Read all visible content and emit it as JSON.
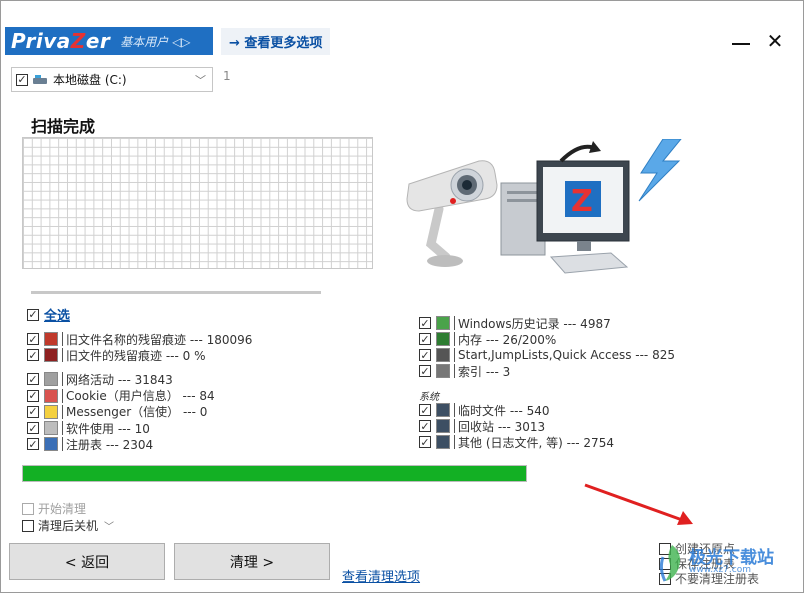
{
  "header": {
    "brand_prefix": "Priva",
    "brand_z": "Z",
    "brand_suffix": "er",
    "brand_sub": "基本用户 ◁▷",
    "more_options": "→ 查看更多选项",
    "close": "✕"
  },
  "drive": {
    "label": "本地磁盘 (C:)",
    "count": "1"
  },
  "scan_status": "扫描完成",
  "select_all": "全选",
  "left_items": [
    {
      "label": "旧文件名称的残留痕迹 ---  180096",
      "icon": "file-names-icon",
      "color": "#c0392b"
    },
    {
      "label": "旧文件的残留痕迹 ---  0 %",
      "icon": "file-grid-icon",
      "color": "#8e2020"
    },
    {
      "label": "网络活动 ---  31843",
      "icon": "fingerprint-icon",
      "color": "#a0a0a0"
    },
    {
      "label": "Cookie（用户信息） ---  84",
      "icon": "cookie-icon",
      "color": "#d9534f"
    },
    {
      "label": "Messenger（信使） ---  0",
      "icon": "messenger-icon",
      "color": "#f4d03f"
    },
    {
      "label": "软件使用 ---  10",
      "icon": "software-icon",
      "color": "#bdbdbd"
    },
    {
      "label": "注册表 --- 2304",
      "icon": "registry-icon",
      "color": "#3b6fb6"
    }
  ],
  "right_items": [
    {
      "label": "Windows历史记录 --- 4987",
      "icon": "history-icon",
      "color": "#4aa34a"
    },
    {
      "label": "内存 --- 26/200%",
      "icon": "memory-icon",
      "color": "#2e7d32"
    },
    {
      "label": "Start,JumpLists,Quick Access --- 825",
      "icon": "jumplist-icon",
      "color": "#555555"
    },
    {
      "label": "索引 --- 3",
      "icon": "index-icon",
      "color": "#777777"
    }
  ],
  "system_label": "系统",
  "system_items": [
    {
      "label": "临时文件 --- 540",
      "icon": "temp-files-icon",
      "color": "#3d4f63"
    },
    {
      "label": "回收站 --- 3013",
      "icon": "recycle-bin-icon",
      "color": "#3d4f63"
    },
    {
      "label": "其他 (日志文件, 等) --- 2754",
      "icon": "other-files-icon",
      "color": "#3d4f63"
    }
  ],
  "progress": {
    "value": 1.0,
    "color": "#13b024"
  },
  "options": {
    "start_clean": "开始清理",
    "shutdown_after": "清理后关机"
  },
  "buttons": {
    "back": "< 返回",
    "clean": "清理 >",
    "clean_options": "查看清理选项"
  },
  "right_options": [
    "创建还原点",
    "保存注册表",
    "不要清理注册表"
  ],
  "watermark": {
    "title": "极光下载站",
    "sub": "www.xz7.com"
  },
  "colors": {
    "accent": "#1f6fc2",
    "link": "#0a50a3",
    "progress": "#13b024",
    "annotation_arrow": "#e02020"
  }
}
